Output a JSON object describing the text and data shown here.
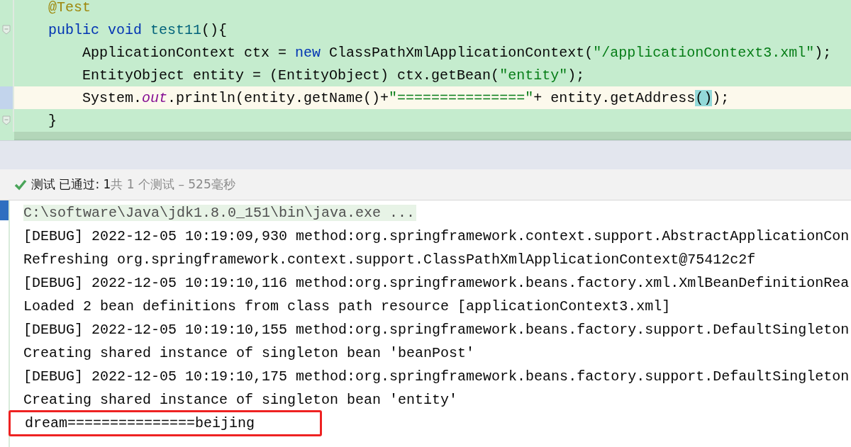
{
  "editor": {
    "lines": [
      {
        "current": false,
        "fold": false,
        "tokens": [
          {
            "kind": "annotation",
            "text": "    @Test"
          }
        ]
      },
      {
        "current": false,
        "fold": true,
        "tokens": [
          {
            "kind": "keyword",
            "text": "    public void "
          },
          {
            "kind": "method",
            "text": "test11"
          },
          {
            "kind": "plain",
            "text": "(){"
          }
        ]
      },
      {
        "current": false,
        "fold": false,
        "tokens": [
          {
            "kind": "plain",
            "text": "        ApplicationContext ctx = "
          },
          {
            "kind": "keyword",
            "text": "new"
          },
          {
            "kind": "plain",
            "text": " ClassPathXmlApplicationContext("
          },
          {
            "kind": "string",
            "text": "\"/applicationContext3.xml\""
          },
          {
            "kind": "plain",
            "text": ");"
          }
        ]
      },
      {
        "current": false,
        "fold": false,
        "tokens": [
          {
            "kind": "plain",
            "text": "        EntityObject entity = (EntityObject) ctx.getBean("
          },
          {
            "kind": "string",
            "text": "\"entity\""
          },
          {
            "kind": "plain",
            "text": ");"
          }
        ]
      },
      {
        "current": true,
        "fold": false,
        "tokens": [
          {
            "kind": "plain",
            "text": "        System."
          },
          {
            "kind": "static_field",
            "text": "out"
          },
          {
            "kind": "plain",
            "text": ".println(entity.getName()+"
          },
          {
            "kind": "string",
            "text": "\"===============\""
          },
          {
            "kind": "plain",
            "text": "+ entity.getAddress"
          },
          {
            "kind": "brace_match",
            "text": "()"
          },
          {
            "kind": "plain",
            "text": ");"
          }
        ]
      },
      {
        "current": false,
        "fold": true,
        "tokens": [
          {
            "kind": "plain",
            "text": "    }"
          }
        ]
      }
    ]
  },
  "test_status": {
    "passed": true,
    "label": "测试 已通过: 1",
    "detail": "共 1 个测试 – 525毫秒"
  },
  "console": {
    "lines": [
      {
        "kind": "command",
        "highlighted": false,
        "text": "C:\\software\\Java\\jdk1.8.0_151\\bin\\java.exe ..."
      },
      {
        "kind": "log",
        "highlighted": false,
        "text": "[DEBUG] 2022-12-05 10:19:09,930 method:org.springframework.context.support.AbstractApplicationCon"
      },
      {
        "kind": "log",
        "highlighted": false,
        "text": "Refreshing org.springframework.context.support.ClassPathXmlApplicationContext@75412c2f"
      },
      {
        "kind": "log",
        "highlighted": false,
        "text": "[DEBUG] 2022-12-05 10:19:10,116 method:org.springframework.beans.factory.xml.XmlBeanDefinitionRea"
      },
      {
        "kind": "log",
        "highlighted": false,
        "text": "Loaded 2 bean definitions from class path resource [applicationContext3.xml]"
      },
      {
        "kind": "log",
        "highlighted": false,
        "text": "[DEBUG] 2022-12-05 10:19:10,155 method:org.springframework.beans.factory.support.DefaultSingleton"
      },
      {
        "kind": "log",
        "highlighted": false,
        "text": "Creating shared instance of singleton bean 'beanPost'"
      },
      {
        "kind": "log",
        "highlighted": false,
        "text": "[DEBUG] 2022-12-05 10:19:10,175 method:org.springframework.beans.factory.support.DefaultSingleton"
      },
      {
        "kind": "log",
        "highlighted": false,
        "text": "Creating shared instance of singleton bean 'entity'"
      },
      {
        "kind": "log",
        "highlighted": true,
        "text": "dream===============beijing"
      }
    ]
  }
}
